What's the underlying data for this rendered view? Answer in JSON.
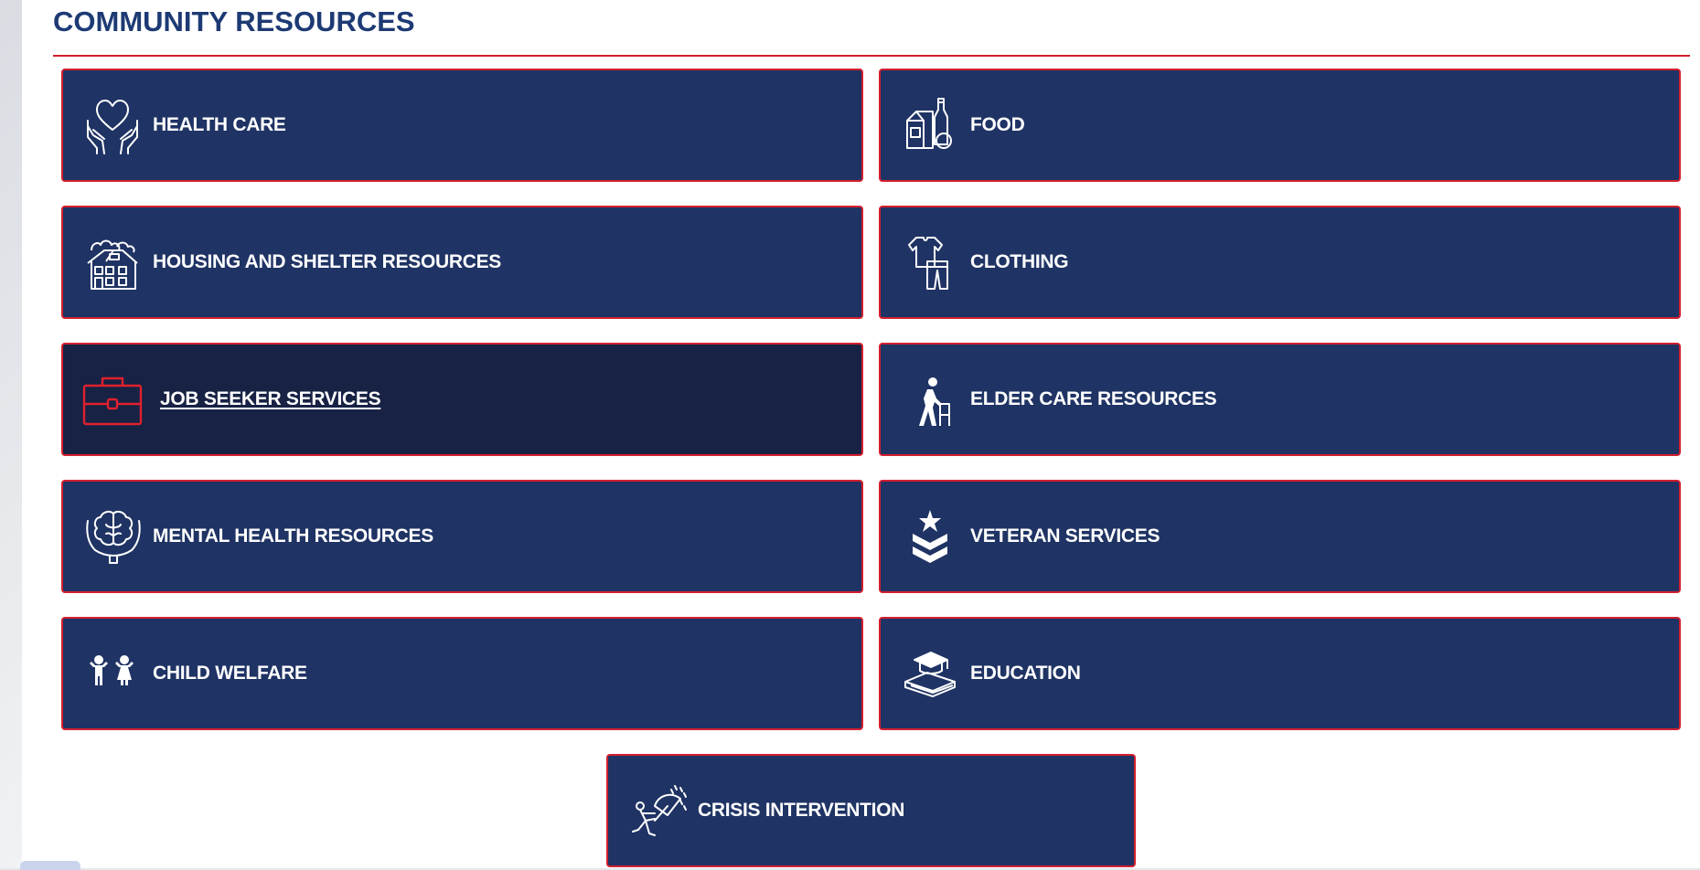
{
  "section": {
    "title": "COMMUNITY RESOURCES"
  },
  "colors": {
    "tile_bg": "#1f3364",
    "tile_active_bg": "#172244",
    "tile_border": "#d41f2f",
    "title_color": "#1d3a74",
    "accent_red": "#d21f2b"
  },
  "tiles": [
    {
      "label": "HEALTH CARE",
      "icon": "heart-hands-icon"
    },
    {
      "label": "FOOD",
      "icon": "grocery-icon"
    },
    {
      "label": "HOUSING AND SHELTER RESOURCES",
      "icon": "house-icon"
    },
    {
      "label": "CLOTHING",
      "icon": "clothing-icon"
    },
    {
      "label": "JOB SEEKER SERVICES",
      "icon": "briefcase-icon",
      "state": "hover"
    },
    {
      "label": "ELDER CARE RESOURCES",
      "icon": "elder-walker-icon"
    },
    {
      "label": "MENTAL HEALTH RESOURCES",
      "icon": "brain-icon"
    },
    {
      "label": "VETERAN SERVICES",
      "icon": "military-rank-icon"
    },
    {
      "label": "CHILD WELFARE",
      "icon": "children-icon"
    },
    {
      "label": "EDUCATION",
      "icon": "graduation-cap-icon"
    },
    {
      "label": "CRISIS INTERVENTION",
      "icon": "umbrella-storm-icon"
    }
  ]
}
